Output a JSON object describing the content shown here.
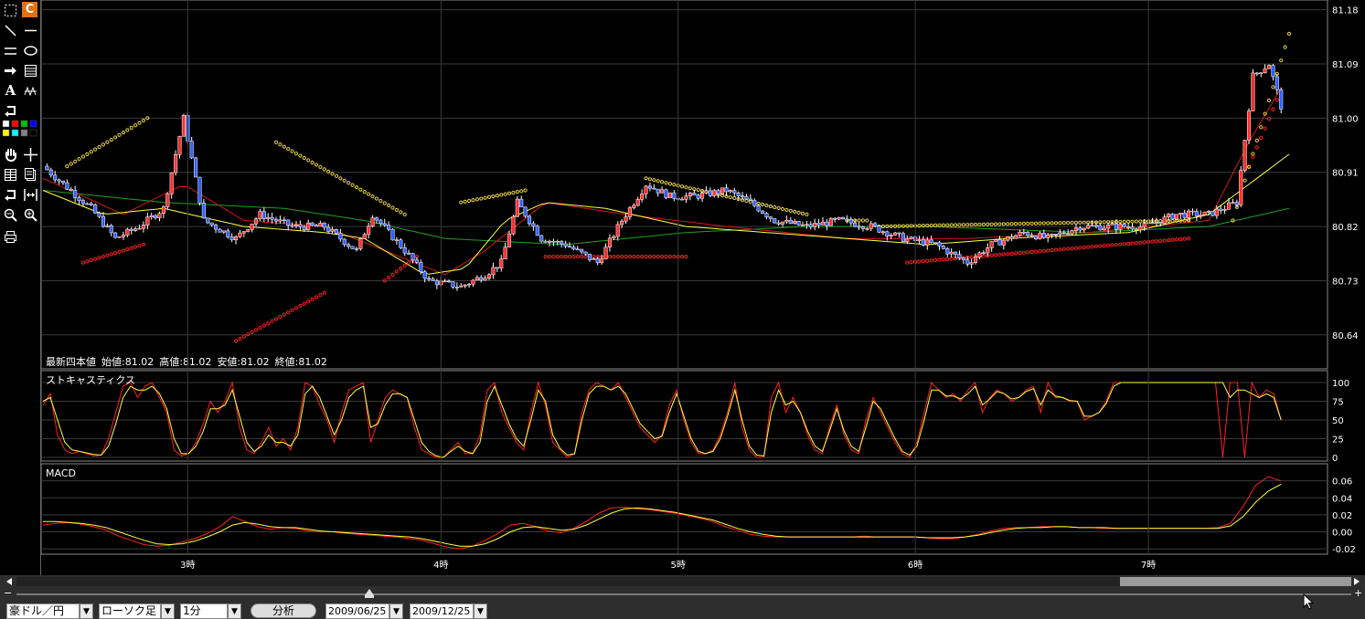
{
  "toolbar": {
    "icons": [
      "select-rect-icon",
      "c-icon",
      "trendline-icon",
      "hline-icon",
      "parallel-lines-icon",
      "ellipse-icon",
      "arrow-icon",
      "fibonacci-icon",
      "text-icon",
      "zigzag-icon",
      "undo-icon",
      "palette-icon",
      "hand-icon",
      "crosshair-icon",
      "grid-icon",
      "clipboard-icon",
      "redo-icon",
      "fit-width-icon",
      "zoom-out-icon",
      "zoom-in-icon",
      "print-icon"
    ],
    "text_tool_label": "A",
    "c_tool_label": "C",
    "palette_colors": [
      "#ffffff",
      "#ff0000",
      "#00c000",
      "#0000ff",
      "#ffff00",
      "#00ffff",
      "#808080",
      "#000000"
    ]
  },
  "colors": {
    "bull": "#ff3030",
    "bear": "#3060ff",
    "sar_up": "#ff2020",
    "sar_dn": "#e8d040",
    "ma_fast": "#ffff40",
    "ma_mid": "#d01818",
    "ma_slow": "#20a020",
    "grid": "#3a3a3a"
  },
  "main_chart": {
    "info_label": "最新四本値",
    "ohlc": [
      {
        "label": "始値:",
        "value": "81.02"
      },
      {
        "label": "高値:",
        "value": "81.02"
      },
      {
        "label": "安値:",
        "value": "81.02"
      },
      {
        "label": "終値:",
        "value": "81.02"
      }
    ],
    "y_ticks": [
      "81.18",
      "81.09",
      "81.00",
      "80.91",
      "80.82",
      "80.73",
      "80.64"
    ],
    "ylim": [
      80.62,
      81.19
    ],
    "x_ticks": [
      "3時",
      "4時",
      "5時",
      "6時",
      "7時"
    ]
  },
  "stoch_chart": {
    "title": "ストキャスティクス",
    "y_ticks": [
      "100",
      "75",
      "50",
      "25",
      "0"
    ],
    "ylim": [
      0,
      100
    ]
  },
  "macd_chart": {
    "title": "MACD",
    "y_ticks": [
      "0.06",
      "0.04",
      "0.02",
      "0.00",
      "-0.02"
    ],
    "ylim": [
      -0.022,
      0.065
    ]
  },
  "chart_data": [
    {
      "type": "candlestick",
      "title": "",
      "x": [
        "3時",
        "4時",
        "5時",
        "6時",
        "7時"
      ],
      "ylim": [
        80.62,
        81.19
      ],
      "grid": true,
      "anchors": [
        [
          0,
          80.92
        ],
        [
          12,
          80.85
        ],
        [
          18,
          80.8
        ],
        [
          24,
          80.82
        ],
        [
          30,
          80.85
        ],
        [
          35,
          81.0
        ],
        [
          40,
          80.83
        ],
        [
          48,
          80.8
        ],
        [
          54,
          80.84
        ],
        [
          62,
          80.82
        ],
        [
          70,
          80.82
        ],
        [
          78,
          80.78
        ],
        [
          82,
          80.84
        ],
        [
          90,
          80.78
        ],
        [
          96,
          80.73
        ],
        [
          104,
          80.72
        ],
        [
          110,
          80.74
        ],
        [
          114,
          80.76
        ],
        [
          118,
          80.86
        ],
        [
          124,
          80.8
        ],
        [
          130,
          80.79
        ],
        [
          138,
          80.76
        ],
        [
          144,
          80.83
        ],
        [
          150,
          80.89
        ],
        [
          156,
          80.87
        ],
        [
          162,
          80.87
        ],
        [
          170,
          80.88
        ],
        [
          176,
          80.86
        ],
        [
          182,
          80.83
        ],
        [
          190,
          80.82
        ],
        [
          198,
          80.83
        ],
        [
          206,
          80.82
        ],
        [
          214,
          80.8
        ],
        [
          222,
          80.79
        ],
        [
          230,
          80.76
        ],
        [
          236,
          80.79
        ],
        [
          244,
          80.81
        ],
        [
          250,
          80.8
        ],
        [
          258,
          80.82
        ],
        [
          266,
          80.82
        ],
        [
          274,
          80.82
        ],
        [
          282,
          80.84
        ],
        [
          290,
          80.84
        ],
        [
          297,
          80.86
        ],
        [
          301,
          81.07
        ],
        [
          305,
          81.09
        ],
        [
          308,
          81.02
        ]
      ],
      "sar_up": [
        [
          10,
          80.76
        ],
        [
          25,
          80.79
        ],
        [
          48,
          80.63
        ],
        [
          70,
          80.71
        ],
        [
          85,
          80.73
        ],
        [
          93,
          80.77
        ],
        [
          125,
          80.77
        ],
        [
          160,
          80.77
        ],
        [
          215,
          80.76
        ],
        [
          285,
          80.8
        ],
        [
          300,
          80.92
        ],
        [
          307,
          81.03
        ]
      ],
      "sar_dn": [
        [
          6,
          80.92
        ],
        [
          26,
          81.0
        ],
        [
          58,
          80.96
        ],
        [
          90,
          80.84
        ],
        [
          104,
          80.86
        ],
        [
          120,
          80.88
        ],
        [
          150,
          80.9
        ],
        [
          190,
          80.84
        ],
        [
          200,
          80.83
        ],
        [
          205,
          80.83
        ],
        [
          208,
          80.82
        ],
        [
          285,
          80.83
        ],
        [
          296,
          80.83
        ],
        [
          310,
          81.14
        ]
      ],
      "ma_fast": [
        [
          0,
          80.88
        ],
        [
          15,
          80.84
        ],
        [
          30,
          80.85
        ],
        [
          50,
          80.82
        ],
        [
          70,
          80.81
        ],
        [
          80,
          80.8
        ],
        [
          95,
          80.74
        ],
        [
          105,
          80.75
        ],
        [
          115,
          80.83
        ],
        [
          125,
          80.86
        ],
        [
          140,
          80.85
        ],
        [
          160,
          80.82
        ],
        [
          180,
          80.81
        ],
        [
          200,
          80.8
        ],
        [
          220,
          80.79
        ],
        [
          240,
          80.8
        ],
        [
          270,
          80.81
        ],
        [
          290,
          80.84
        ],
        [
          310,
          80.94
        ]
      ],
      "ma_mid": [
        [
          0,
          80.9
        ],
        [
          20,
          80.84
        ],
        [
          35,
          80.89
        ],
        [
          50,
          80.83
        ],
        [
          70,
          80.82
        ],
        [
          85,
          80.78
        ],
        [
          100,
          80.74
        ],
        [
          110,
          80.78
        ],
        [
          125,
          80.86
        ],
        [
          145,
          80.84
        ],
        [
          170,
          80.82
        ],
        [
          200,
          80.8
        ],
        [
          230,
          80.8
        ],
        [
          260,
          80.81
        ],
        [
          290,
          80.83
        ],
        [
          300,
          80.96
        ],
        [
          308,
          81.05
        ]
      ],
      "ma_slow": [
        [
          0,
          80.88
        ],
        [
          30,
          80.86
        ],
        [
          60,
          80.85
        ],
        [
          80,
          80.83
        ],
        [
          100,
          80.8
        ],
        [
          130,
          80.79
        ],
        [
          160,
          80.81
        ],
        [
          190,
          80.82
        ],
        [
          220,
          80.82
        ],
        [
          260,
          80.81
        ],
        [
          290,
          80.82
        ],
        [
          310,
          80.85
        ]
      ]
    },
    {
      "type": "line",
      "title": "ストキャスティクス",
      "ylim": [
        0,
        100
      ],
      "series": [
        {
          "color": "#ff2020",
          "values": [
            70,
            85,
            30,
            10,
            5,
            8,
            5,
            2,
            3,
            25,
            60,
            95,
            100,
            80,
            95,
            100,
            80,
            60,
            10,
            2,
            5,
            20,
            45,
            75,
            60,
            75,
            100,
            40,
            10,
            5,
            20,
            40,
            15,
            25,
            10,
            40,
            100,
            95,
            70,
            50,
            20,
            60,
            90,
            95,
            100,
            20,
            50,
            80,
            90,
            85,
            80,
            40,
            10,
            5,
            0,
            0,
            10,
            20,
            5,
            5,
            30,
            90,
            100,
            60,
            40,
            20,
            10,
            60,
            100,
            70,
            20,
            10,
            0,
            5,
            60,
            90,
            100,
            95,
            90,
            100,
            80,
            60,
            40,
            30,
            20,
            30,
            70,
            90,
            50,
            20,
            5,
            5,
            10,
            30,
            60,
            100,
            40,
            10,
            0,
            0,
            80,
            100,
            60,
            80,
            60,
            30,
            10,
            5,
            40,
            70,
            30,
            10,
            5,
            50,
            80,
            60,
            40,
            20,
            5,
            0,
            20,
            60,
            100,
            90,
            80,
            85,
            75,
            90,
            100,
            60,
            80,
            90,
            85,
            75,
            80,
            90,
            95,
            60,
            100,
            80,
            80,
            75,
            75,
            50,
            55,
            60,
            75,
            100,
            100,
            100,
            100,
            100,
            100,
            100,
            100,
            100,
            100,
            100,
            100,
            100,
            100,
            100,
            0,
            100,
            100,
            0,
            100,
            80,
            90,
            85,
            50
          ]
        },
        {
          "color": "#ffff40",
          "values": [
            75,
            80,
            50,
            20,
            10,
            8,
            6,
            4,
            3,
            15,
            45,
            80,
            95,
            90,
            90,
            95,
            85,
            65,
            25,
            5,
            5,
            15,
            35,
            65,
            65,
            70,
            90,
            55,
            20,
            8,
            15,
            30,
            20,
            20,
            15,
            30,
            85,
            95,
            80,
            55,
            30,
            50,
            80,
            90,
            95,
            40,
            45,
            70,
            85,
            85,
            80,
            50,
            20,
            8,
            2,
            0,
            8,
            15,
            8,
            5,
            20,
            75,
            95,
            70,
            45,
            25,
            15,
            50,
            90,
            75,
            30,
            12,
            3,
            5,
            50,
            85,
            95,
            95,
            90,
            95,
            85,
            65,
            45,
            35,
            25,
            28,
            60,
            85,
            55,
            25,
            8,
            5,
            8,
            25,
            55,
            90,
            50,
            15,
            3,
            2,
            60,
            90,
            70,
            75,
            60,
            35,
            15,
            8,
            35,
            65,
            35,
            15,
            8,
            40,
            75,
            65,
            45,
            25,
            8,
            3,
            15,
            50,
            90,
            90,
            82,
            82,
            78,
            85,
            95,
            70,
            78,
            88,
            85,
            78,
            80,
            88,
            92,
            70,
            90,
            82,
            80,
            76,
            75,
            55,
            55,
            60,
            72,
            95,
            100,
            100,
            100,
            100,
            100,
            100,
            100,
            100,
            100,
            100,
            100,
            100,
            100,
            100,
            100,
            80,
            90,
            90,
            85,
            80,
            85,
            80,
            50
          ]
        }
      ]
    },
    {
      "type": "line",
      "title": "MACD",
      "ylim": [
        -0.022,
        0.065
      ],
      "series": [
        {
          "color": "#ff2020",
          "values": [
            0.008,
            0.01,
            0.011,
            0.009,
            0.006,
            0.002,
            -0.005,
            -0.01,
            -0.015,
            -0.017,
            -0.016,
            -0.012,
            -0.008,
            -0.002,
            0.006,
            0.018,
            0.012,
            0.006,
            0.003,
            0.005,
            0.004,
            0.001,
            0.0,
            0.0,
            -0.002,
            -0.003,
            -0.004,
            -0.005,
            -0.006,
            -0.008,
            -0.01,
            -0.014,
            -0.018,
            -0.02,
            -0.017,
            -0.01,
            -0.002,
            0.008,
            0.01,
            0.006,
            0.001,
            -0.001,
            0.004,
            0.012,
            0.022,
            0.028,
            0.029,
            0.027,
            0.026,
            0.024,
            0.022,
            0.019,
            0.016,
            0.012,
            0.006,
            0.002,
            -0.003,
            -0.005,
            -0.006,
            -0.006,
            -0.006,
            -0.006,
            -0.006,
            -0.006,
            -0.006,
            -0.005,
            -0.006,
            -0.006,
            -0.006,
            -0.006,
            -0.007,
            -0.008,
            -0.008,
            -0.006,
            -0.003,
            0.001,
            0.004,
            0.005,
            0.005,
            0.006,
            0.006,
            0.006,
            0.005,
            0.005,
            0.004,
            0.004,
            0.004,
            0.004,
            0.004,
            0.004,
            0.004,
            0.004,
            0.004,
            0.005,
            0.01,
            0.03,
            0.055,
            0.065,
            0.06
          ]
        },
        {
          "color": "#ffff40",
          "values": [
            0.012,
            0.012,
            0.011,
            0.01,
            0.008,
            0.005,
            0.0,
            -0.005,
            -0.01,
            -0.014,
            -0.015,
            -0.014,
            -0.011,
            -0.006,
            0.0,
            0.008,
            0.011,
            0.009,
            0.006,
            0.005,
            0.005,
            0.003,
            0.001,
            0.0,
            -0.001,
            -0.002,
            -0.003,
            -0.004,
            -0.005,
            -0.006,
            -0.008,
            -0.011,
            -0.014,
            -0.017,
            -0.017,
            -0.014,
            -0.008,
            0.0,
            0.005,
            0.006,
            0.004,
            0.002,
            0.003,
            0.008,
            0.015,
            0.022,
            0.027,
            0.028,
            0.027,
            0.025,
            0.023,
            0.02,
            0.017,
            0.014,
            0.009,
            0.004,
            0.0,
            -0.003,
            -0.005,
            -0.006,
            -0.006,
            -0.006,
            -0.006,
            -0.006,
            -0.006,
            -0.006,
            -0.006,
            -0.006,
            -0.006,
            -0.006,
            -0.007,
            -0.007,
            -0.007,
            -0.006,
            -0.004,
            -0.001,
            0.002,
            0.004,
            0.005,
            0.005,
            0.006,
            0.006,
            0.005,
            0.005,
            0.005,
            0.004,
            0.004,
            0.004,
            0.004,
            0.004,
            0.004,
            0.004,
            0.004,
            0.004,
            0.007,
            0.018,
            0.035,
            0.048,
            0.056
          ]
        }
      ]
    }
  ],
  "footer": {
    "currency_pair": "豪ドル／円",
    "chart_type": "ローソク足",
    "interval": "1分",
    "analyze_button": "分析",
    "date_from": "2009/06/25",
    "date_to": "2009/12/25",
    "zoom_minus": "−",
    "zoom_plus": "+"
  }
}
